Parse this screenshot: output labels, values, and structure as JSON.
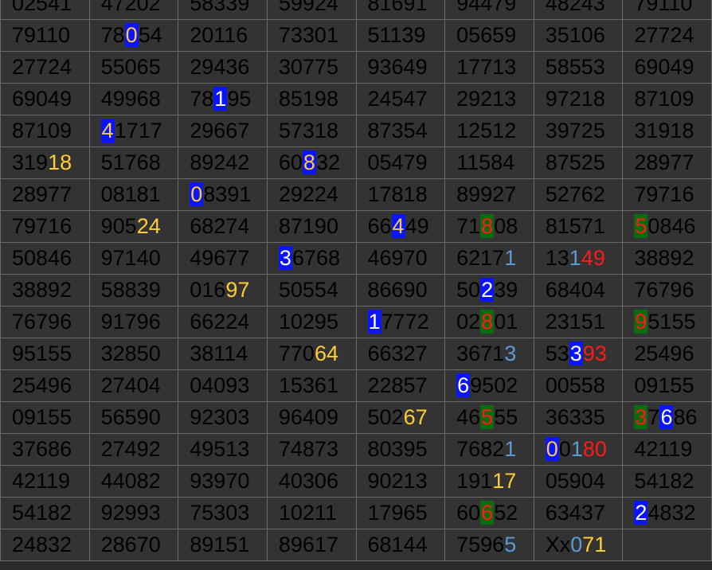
{
  "colors": {
    "background": "#333333",
    "border": "#6a6a6a",
    "default_text": "#000000",
    "blue_box": "#0a14ff",
    "green_box": "#0e6a0e",
    "yellow": "#ffcc33",
    "red": "#ff1a1a",
    "light_blue": "#5b9bd5",
    "white": "#ffffff"
  },
  "rows": [
    [
      [
        {
          "t": "02541"
        }
      ],
      [
        {
          "t": "47202"
        }
      ],
      [
        {
          "t": "58339"
        }
      ],
      [
        {
          "t": "59924"
        }
      ],
      [
        {
          "t": "81691"
        }
      ],
      [
        {
          "t": "94479"
        }
      ],
      [
        {
          "t": "48243"
        }
      ],
      [
        {
          "t": "79110"
        }
      ]
    ],
    [
      [
        {
          "t": "79110"
        }
      ],
      [
        {
          "t": "78"
        },
        {
          "t": "0",
          "c": "yellow",
          "bg": "blue_box"
        },
        {
          "t": "54"
        }
      ],
      [
        {
          "t": "20116"
        }
      ],
      [
        {
          "t": "73301"
        }
      ],
      [
        {
          "t": "51139"
        }
      ],
      [
        {
          "t": "05659"
        }
      ],
      [
        {
          "t": "35106"
        }
      ],
      [
        {
          "t": "27724"
        }
      ]
    ],
    [
      [
        {
          "t": "27724"
        }
      ],
      [
        {
          "t": "55065"
        }
      ],
      [
        {
          "t": "29436"
        }
      ],
      [
        {
          "t": "30775"
        }
      ],
      [
        {
          "t": "93649"
        }
      ],
      [
        {
          "t": "17713"
        }
      ],
      [
        {
          "t": "58553"
        }
      ],
      [
        {
          "t": "69049"
        }
      ]
    ],
    [
      [
        {
          "t": "69049"
        }
      ],
      [
        {
          "t": "49968"
        }
      ],
      [
        {
          "t": "78"
        },
        {
          "t": "1",
          "c": "white",
          "bg": "blue_box"
        },
        {
          "t": "95"
        }
      ],
      [
        {
          "t": "85198"
        }
      ],
      [
        {
          "t": "24547"
        }
      ],
      [
        {
          "t": "29213"
        }
      ],
      [
        {
          "t": "97218"
        }
      ],
      [
        {
          "t": "87109"
        }
      ]
    ],
    [
      [
        {
          "t": "87109"
        }
      ],
      [
        {
          "t": "4",
          "c": "yellow",
          "bg": "blue_box"
        },
        {
          "t": "1717"
        }
      ],
      [
        {
          "t": "29667"
        }
      ],
      [
        {
          "t": "57318"
        }
      ],
      [
        {
          "t": "87354"
        }
      ],
      [
        {
          "t": "12512"
        }
      ],
      [
        {
          "t": "39725"
        }
      ],
      [
        {
          "t": "31918"
        }
      ]
    ],
    [
      [
        {
          "t": "319"
        },
        {
          "t": "18",
          "c": "yellow"
        }
      ],
      [
        {
          "t": "51768"
        }
      ],
      [
        {
          "t": "89242"
        }
      ],
      [
        {
          "t": "60"
        },
        {
          "t": "8",
          "c": "yellow",
          "bg": "blue_box"
        },
        {
          "t": "32"
        }
      ],
      [
        {
          "t": "05479"
        }
      ],
      [
        {
          "t": "11584"
        }
      ],
      [
        {
          "t": "87525"
        }
      ],
      [
        {
          "t": "28977"
        }
      ]
    ],
    [
      [
        {
          "t": "28977"
        }
      ],
      [
        {
          "t": "08181"
        }
      ],
      [
        {
          "t": "0",
          "c": "yellow",
          "bg": "blue_box"
        },
        {
          "t": "8391"
        }
      ],
      [
        {
          "t": "29224"
        }
      ],
      [
        {
          "t": "17818"
        }
      ],
      [
        {
          "t": "89927"
        }
      ],
      [
        {
          "t": "52762"
        }
      ],
      [
        {
          "t": "79716"
        }
      ]
    ],
    [
      [
        {
          "t": "79716"
        }
      ],
      [
        {
          "t": "905"
        },
        {
          "t": "24",
          "c": "yellow"
        }
      ],
      [
        {
          "t": "68274"
        }
      ],
      [
        {
          "t": "87190"
        }
      ],
      [
        {
          "t": "66"
        },
        {
          "t": "4",
          "c": "yellow",
          "bg": "blue_box"
        },
        {
          "t": "49"
        }
      ],
      [
        {
          "t": "71"
        },
        {
          "t": "8",
          "c": "red",
          "bg": "green_box"
        },
        {
          "t": "08"
        }
      ],
      [
        {
          "t": "81571"
        }
      ],
      [
        {
          "t": "5",
          "c": "red",
          "bg": "green_box"
        },
        {
          "t": "0846"
        }
      ]
    ],
    [
      [
        {
          "t": "50846"
        }
      ],
      [
        {
          "t": "97140"
        }
      ],
      [
        {
          "t": "49677"
        }
      ],
      [
        {
          "t": "3",
          "c": "white",
          "bg": "blue_box"
        },
        {
          "t": "6768"
        }
      ],
      [
        {
          "t": "46970"
        }
      ],
      [
        {
          "t": "6217"
        },
        {
          "t": "1",
          "c": "light_blue"
        }
      ],
      [
        {
          "t": "13"
        },
        {
          "t": "1",
          "c": "light_blue"
        },
        {
          "t": "49",
          "c": "red"
        }
      ],
      [
        {
          "t": "38892"
        }
      ]
    ],
    [
      [
        {
          "t": "38892"
        }
      ],
      [
        {
          "t": "58839"
        }
      ],
      [
        {
          "t": "016"
        },
        {
          "t": "97",
          "c": "yellow"
        }
      ],
      [
        {
          "t": "50554"
        }
      ],
      [
        {
          "t": "86690"
        }
      ],
      [
        {
          "t": "50"
        },
        {
          "t": "2",
          "c": "white",
          "bg": "blue_box"
        },
        {
          "t": "39"
        }
      ],
      [
        {
          "t": "68404"
        }
      ],
      [
        {
          "t": "76796"
        }
      ]
    ],
    [
      [
        {
          "t": "76796"
        }
      ],
      [
        {
          "t": "91796"
        }
      ],
      [
        {
          "t": "66224"
        }
      ],
      [
        {
          "t": "10295"
        }
      ],
      [
        {
          "t": "1",
          "c": "white",
          "bg": "blue_box"
        },
        {
          "t": "7772"
        }
      ],
      [
        {
          "t": "02"
        },
        {
          "t": "8",
          "c": "red",
          "bg": "green_box"
        },
        {
          "t": "01"
        }
      ],
      [
        {
          "t": "23151"
        }
      ],
      [
        {
          "t": "9",
          "c": "red",
          "bg": "green_box"
        },
        {
          "t": "5155"
        }
      ]
    ],
    [
      [
        {
          "t": "95155"
        }
      ],
      [
        {
          "t": "32850"
        }
      ],
      [
        {
          "t": "38114"
        }
      ],
      [
        {
          "t": "770"
        },
        {
          "t": "64",
          "c": "yellow"
        }
      ],
      [
        {
          "t": "66327"
        }
      ],
      [
        {
          "t": "3671"
        },
        {
          "t": "3",
          "c": "light_blue"
        }
      ],
      [
        {
          "t": "53"
        },
        {
          "t": "3",
          "c": "white",
          "bg": "blue_box"
        },
        {
          "t": "93",
          "c": "red"
        }
      ],
      [
        {
          "t": "25496"
        }
      ]
    ],
    [
      [
        {
          "t": "25496"
        }
      ],
      [
        {
          "t": "27404"
        }
      ],
      [
        {
          "t": "04093"
        }
      ],
      [
        {
          "t": "15361"
        }
      ],
      [
        {
          "t": "22857"
        }
      ],
      [
        {
          "t": "6",
          "c": "white",
          "bg": "blue_box"
        },
        {
          "t": "9502"
        }
      ],
      [
        {
          "t": "00558"
        }
      ],
      [
        {
          "t": "09155"
        }
      ]
    ],
    [
      [
        {
          "t": "09155"
        }
      ],
      [
        {
          "t": "56590"
        }
      ],
      [
        {
          "t": "92303"
        }
      ],
      [
        {
          "t": "96409"
        }
      ],
      [
        {
          "t": "502"
        },
        {
          "t": "67",
          "c": "yellow"
        }
      ],
      [
        {
          "t": "46"
        },
        {
          "t": "5",
          "c": "red",
          "bg": "green_box"
        },
        {
          "t": "55"
        }
      ],
      [
        {
          "t": "36335"
        }
      ],
      [
        {
          "t": "3",
          "c": "red",
          "bg": "green_box"
        },
        {
          "t": "7"
        },
        {
          "t": "6",
          "c": "white",
          "bg": "blue_box"
        },
        {
          "t": "86"
        }
      ]
    ],
    [
      [
        {
          "t": "37686"
        }
      ],
      [
        {
          "t": "27492"
        }
      ],
      [
        {
          "t": "49513"
        }
      ],
      [
        {
          "t": "74873"
        }
      ],
      [
        {
          "t": "80395"
        }
      ],
      [
        {
          "t": "7682"
        },
        {
          "t": "1",
          "c": "light_blue"
        }
      ],
      [
        {
          "t": "0",
          "c": "yellow",
          "bg": "blue_box"
        },
        {
          "t": "0"
        },
        {
          "t": "1",
          "c": "light_blue"
        },
        {
          "t": "80",
          "c": "red"
        }
      ],
      [
        {
          "t": "42119"
        }
      ]
    ],
    [
      [
        {
          "t": "42119"
        }
      ],
      [
        {
          "t": "44082"
        }
      ],
      [
        {
          "t": "93970"
        }
      ],
      [
        {
          "t": "40306"
        }
      ],
      [
        {
          "t": "90213"
        }
      ],
      [
        {
          "t": "191"
        },
        {
          "t": "17",
          "c": "yellow"
        }
      ],
      [
        {
          "t": "05904"
        }
      ],
      [
        {
          "t": "54182"
        }
      ]
    ],
    [
      [
        {
          "t": "54182"
        }
      ],
      [
        {
          "t": "92993"
        }
      ],
      [
        {
          "t": "75303"
        }
      ],
      [
        {
          "t": "10211"
        }
      ],
      [
        {
          "t": "17965"
        }
      ],
      [
        {
          "t": "60"
        },
        {
          "t": "6",
          "c": "red",
          "bg": "green_box"
        },
        {
          "t": "52"
        }
      ],
      [
        {
          "t": "63437"
        }
      ],
      [
        {
          "t": "2",
          "c": "white",
          "bg": "blue_box"
        },
        {
          "t": "4832"
        }
      ]
    ],
    [
      [
        {
          "t": "24832"
        }
      ],
      [
        {
          "t": "28670"
        }
      ],
      [
        {
          "t": "89151"
        }
      ],
      [
        {
          "t": "89617"
        }
      ],
      [
        {
          "t": "68144"
        }
      ],
      [
        {
          "t": "7596"
        },
        {
          "t": "5",
          "c": "light_blue"
        }
      ],
      [
        {
          "t": "Xx"
        },
        {
          "t": "0",
          "c": "light_blue"
        },
        {
          "t": "71",
          "c": "yellow"
        }
      ],
      []
    ]
  ]
}
